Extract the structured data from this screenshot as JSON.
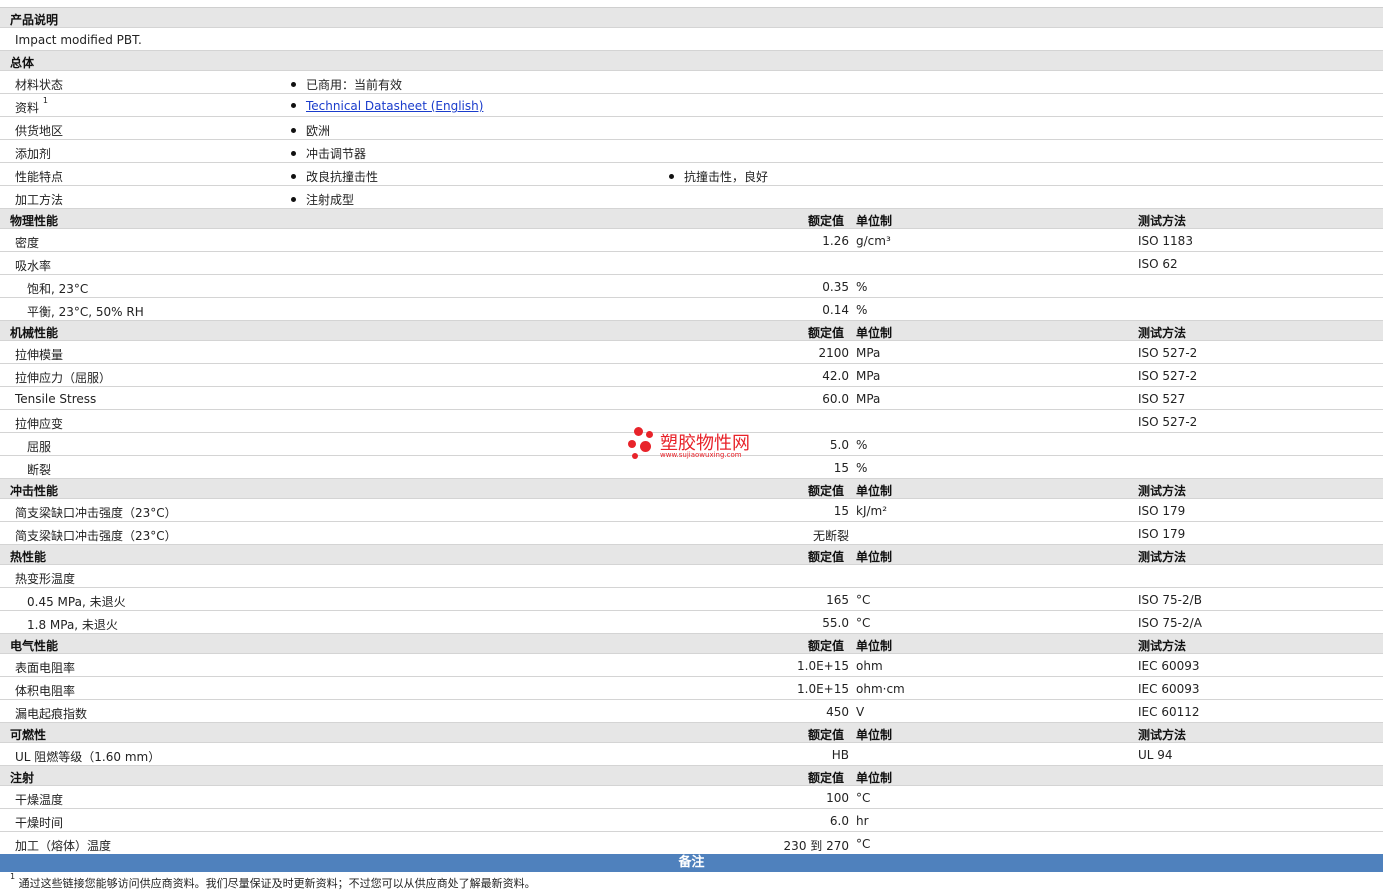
{
  "headers": {
    "value": "额定值",
    "unit": "单位制",
    "test": "测试方法"
  },
  "description": {
    "title": "产品说明",
    "text": "Impact modified PBT."
  },
  "general": {
    "title": "总体",
    "rows": [
      {
        "label": "材料状态",
        "items": [
          "已商用：当前有效"
        ]
      },
      {
        "label": "资料",
        "sup": "1",
        "items": [
          "Technical Datasheet (English)"
        ],
        "link": true
      },
      {
        "label": "供货地区",
        "items": [
          "欧洲"
        ]
      },
      {
        "label": "添加剂",
        "items": [
          "冲击调节器"
        ]
      },
      {
        "label": "性能特点",
        "items": [
          "改良抗撞击性",
          "抗撞击性，良好"
        ]
      },
      {
        "label": "加工方法",
        "items": [
          "注射成型"
        ]
      }
    ]
  },
  "physical": {
    "title": "物理性能",
    "rows": [
      {
        "label": "密度",
        "value": "1.26",
        "unit": "g/cm³",
        "test": "ISO 1183"
      },
      {
        "label": "吸水率",
        "value": "",
        "unit": "",
        "test": "ISO 62"
      },
      {
        "label": "饱和, 23°C",
        "value": "0.35",
        "unit": "%",
        "test": "",
        "sub": true
      },
      {
        "label": "平衡, 23°C, 50% RH",
        "value": "0.14",
        "unit": "%",
        "test": "",
        "sub": true
      }
    ]
  },
  "mechanical": {
    "title": "机械性能",
    "rows": [
      {
        "label": "拉伸模量",
        "value": "2100",
        "unit": "MPa",
        "test": "ISO 527-2"
      },
      {
        "label": "拉伸应力（屈服）",
        "value": "42.0",
        "unit": "MPa",
        "test": "ISO 527-2"
      },
      {
        "label": "Tensile Stress",
        "value": "60.0",
        "unit": "MPa",
        "test": "ISO 527"
      },
      {
        "label": "拉伸应变",
        "value": "",
        "unit": "",
        "test": "ISO 527-2"
      },
      {
        "label": "屈服",
        "value": "5.0",
        "unit": "%",
        "test": "",
        "sub": true
      },
      {
        "label": "断裂",
        "value": "15",
        "unit": "%",
        "test": "",
        "sub": true
      }
    ]
  },
  "impact": {
    "title": "冲击性能",
    "rows": [
      {
        "label": "简支梁缺口冲击强度（23°C）",
        "value": "15",
        "unit": "kJ/m²",
        "test": "ISO 179"
      },
      {
        "label": "简支梁缺口冲击强度（23°C）",
        "value": "无断裂",
        "unit": "",
        "test": "ISO 179"
      }
    ]
  },
  "thermal": {
    "title": "热性能",
    "rows": [
      {
        "label": "热变形温度",
        "value": "",
        "unit": "",
        "test": ""
      },
      {
        "label": "0.45 MPa, 未退火",
        "value": "165",
        "unit": "°C",
        "test": "ISO 75-2/B",
        "sub": true
      },
      {
        "label": "1.8 MPa, 未退火",
        "value": "55.0",
        "unit": "°C",
        "test": "ISO 75-2/A",
        "sub": true
      }
    ]
  },
  "electrical": {
    "title": "电气性能",
    "rows": [
      {
        "label": "表面电阻率",
        "value": "1.0E+15",
        "unit": "ohm",
        "test": "IEC 60093"
      },
      {
        "label": "体积电阻率",
        "value": "1.0E+15",
        "unit": "ohm·cm",
        "test": "IEC 60093"
      },
      {
        "label": "漏电起痕指数",
        "value": "450",
        "unit": "V",
        "test": "IEC 60112"
      }
    ]
  },
  "flammability": {
    "title": "可燃性",
    "rows": [
      {
        "label": "UL 阻燃等级（1.60 mm）",
        "value": "HB",
        "unit": "",
        "test": "UL 94"
      }
    ]
  },
  "injection": {
    "title": "注射",
    "rows": [
      {
        "label": "干燥温度",
        "value": "100",
        "unit": "°C",
        "test": ""
      },
      {
        "label": "干燥时间",
        "value": "6.0",
        "unit": "hr",
        "test": ""
      },
      {
        "label": "加工（熔体）温度",
        "value": "230 到  270",
        "unit": "°C",
        "test": ""
      }
    ]
  },
  "notes": {
    "title": "备注",
    "sup": "1",
    "text": "通过这些链接您能够访问供应商资料。我们尽量保证及时更新资料；不过您可以从供应商处了解最新资料。"
  },
  "watermark": {
    "cn": "塑胶物性网",
    "en": "www.sujiaowuxing.com",
    "color": "#e8232a"
  }
}
